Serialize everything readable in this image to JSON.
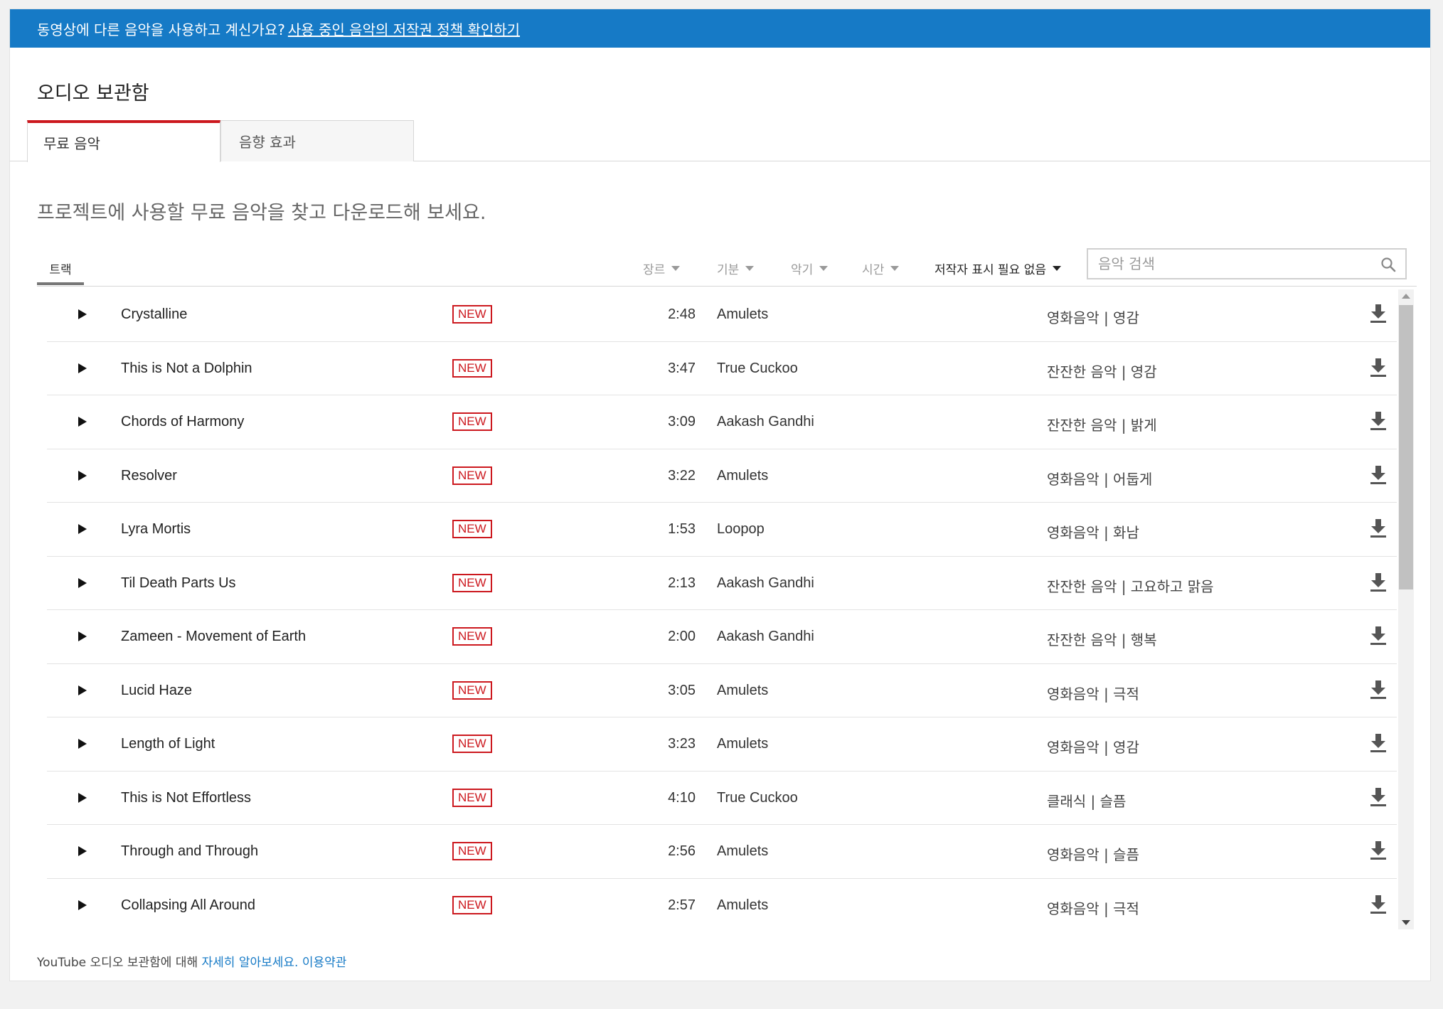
{
  "banner": {
    "text": "동영상에 다른 음악을 사용하고 계신가요?",
    "link": "사용 중인 음악의 저작권 정책 확인하기"
  },
  "page_title": "오디오 보관함",
  "tabs": [
    {
      "label": "무료 음악",
      "active": true
    },
    {
      "label": "음향 효과",
      "active": false
    }
  ],
  "subtitle": "프로젝트에 사용할 무료 음악을 찾고 다운로드해 보세요.",
  "filters": {
    "track_tab": "트랙",
    "genre": "장르",
    "mood": "기분",
    "instrument": "악기",
    "duration": "시간",
    "attribution": "저작자 표시 필요 없음"
  },
  "search": {
    "placeholder": "음악 검색",
    "value": ""
  },
  "new_badge": "NEW",
  "tracks": [
    {
      "title": "Crystalline",
      "duration": "2:48",
      "artist": "Amulets",
      "genre_mood": "영화음악 | 영감"
    },
    {
      "title": "This is Not a Dolphin",
      "duration": "3:47",
      "artist": "True Cuckoo",
      "genre_mood": "잔잔한 음악 | 영감"
    },
    {
      "title": "Chords of Harmony",
      "duration": "3:09",
      "artist": "Aakash Gandhi",
      "genre_mood": "잔잔한 음악 | 밝게"
    },
    {
      "title": "Resolver",
      "duration": "3:22",
      "artist": "Amulets",
      "genre_mood": "영화음악 | 어둡게"
    },
    {
      "title": "Lyra Mortis",
      "duration": "1:53",
      "artist": "Loopop",
      "genre_mood": "영화음악 | 화남"
    },
    {
      "title": "Til Death Parts Us",
      "duration": "2:13",
      "artist": "Aakash Gandhi",
      "genre_mood": "잔잔한 음악 | 고요하고 맑음"
    },
    {
      "title": "Zameen - Movement of Earth",
      "duration": "2:00",
      "artist": "Aakash Gandhi",
      "genre_mood": "잔잔한 음악 | 행복"
    },
    {
      "title": "Lucid Haze",
      "duration": "3:05",
      "artist": "Amulets",
      "genre_mood": "영화음악 | 극적"
    },
    {
      "title": "Length of Light",
      "duration": "3:23",
      "artist": "Amulets",
      "genre_mood": "영화음악 | 영감"
    },
    {
      "title": "This is Not Effortless",
      "duration": "4:10",
      "artist": "True Cuckoo",
      "genre_mood": "클래식 | 슬픔"
    },
    {
      "title": "Through and Through",
      "duration": "2:56",
      "artist": "Amulets",
      "genre_mood": "영화음악 | 슬픔"
    },
    {
      "title": "Collapsing All Around",
      "duration": "2:57",
      "artist": "Amulets",
      "genre_mood": "영화음악 | 극적"
    }
  ],
  "footer": {
    "text": "YouTube 오디오 보관함에 대해",
    "learn_more": "자세히 알아보세요.",
    "terms": "이용약관"
  },
  "icons": {
    "play": "play-icon",
    "download": "download-icon",
    "search": "search-icon",
    "caret": "caret-down-icon"
  },
  "colors": {
    "banner": "#167ac6",
    "accent_red": "#cc181e",
    "link": "#167ac6"
  }
}
